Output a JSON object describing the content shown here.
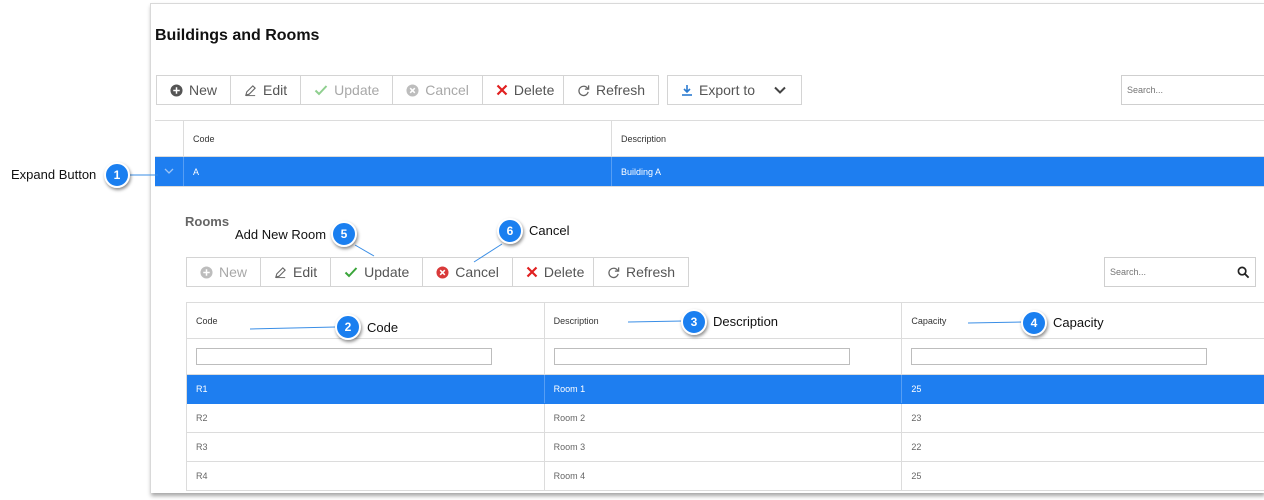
{
  "page_title": "Buildings and Rooms",
  "toolbar": {
    "new": "New",
    "edit": "Edit",
    "update": "Update",
    "cancel": "Cancel",
    "delete": "Delete",
    "refresh": "Refresh",
    "export": "Export to",
    "search_placeholder": "Search..."
  },
  "buildings_grid": {
    "columns": [
      "Code",
      "Description"
    ],
    "rows": [
      {
        "code": "A",
        "description": "Building A"
      }
    ]
  },
  "rooms": {
    "title": "Rooms",
    "toolbar": {
      "new": "New",
      "edit": "Edit",
      "update": "Update",
      "cancel": "Cancel",
      "delete": "Delete",
      "refresh": "Refresh",
      "search_placeholder": "Search..."
    },
    "columns": [
      "Code",
      "Description",
      "Capacity"
    ],
    "rows": [
      {
        "code": "R1",
        "description": "Room 1",
        "capacity": "25"
      },
      {
        "code": "R2",
        "description": "Room 2",
        "capacity": "23"
      },
      {
        "code": "R3",
        "description": "Room 3",
        "capacity": "22"
      },
      {
        "code": "R4",
        "description": "Room 4",
        "capacity": "25"
      }
    ]
  },
  "callouts": [
    {
      "number": "1",
      "label": "Expand Button"
    },
    {
      "number": "2",
      "label": "Code"
    },
    {
      "number": "3",
      "label": "Description"
    },
    {
      "number": "4",
      "label": "Capacity"
    },
    {
      "number": "5",
      "label": "Add New Room"
    },
    {
      "number": "6",
      "label": "Cancel"
    }
  ],
  "colors": {
    "accent": "#1e7ef0",
    "callout": "#1a7ff0",
    "delete_red": "#e02020",
    "update_green": "#3aa53a"
  },
  "icons": {
    "new": "plus-circle-icon",
    "edit": "pencil-icon",
    "update": "check-icon",
    "cancel": "x-circle-icon",
    "delete": "x-icon",
    "refresh": "refresh-icon",
    "export": "download-icon",
    "search": "search-icon",
    "expand": "chevron-down-icon"
  }
}
